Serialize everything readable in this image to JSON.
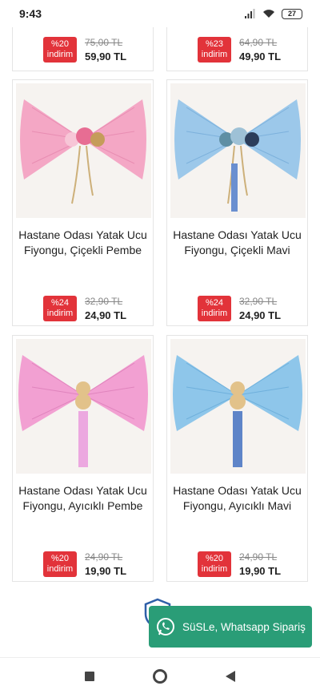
{
  "status_bar": {
    "time": "9:43",
    "battery": "27"
  },
  "products_top": [
    {
      "discount_pct": "%20",
      "discount_word": "indirim",
      "old_price": "75,00 TL",
      "new_price": "59,90 TL"
    },
    {
      "discount_pct": "%23",
      "discount_word": "indirim",
      "old_price": "64,90 TL",
      "new_price": "49,90 TL"
    }
  ],
  "products": [
    {
      "title": "Hastane Odası Yatak Ucu Fiyongu, Çiçekli Pembe",
      "discount_pct": "%24",
      "discount_word": "indirim",
      "old_price": "32,90 TL",
      "new_price": "24,90 TL",
      "color": "#f4a7c5",
      "image_icon": "pink-bow-flowers"
    },
    {
      "title": "Hastane Odası Yatak Ucu Fiyongu, Çiçekli Mavi",
      "discount_pct": "%24",
      "discount_word": "indirim",
      "old_price": "32,90 TL",
      "new_price": "24,90 TL",
      "color": "#9cc8ea",
      "image_icon": "blue-bow-flowers"
    },
    {
      "title": "Hastane Odası Yatak Ucu Fiyongu, Ayıcıklı Pembe",
      "discount_pct": "%20",
      "discount_word": "indirim",
      "old_price": "24,90 TL",
      "new_price": "19,90 TL",
      "color": "#f2a0d2",
      "image_icon": "pink-bow-teddy"
    },
    {
      "title": "Hastane Odası Yatak Ucu Fiyongu, Ayıcıklı Mavi",
      "discount_pct": "%20",
      "discount_word": "indirim",
      "old_price": "24,90 TL",
      "new_price": "19,90 TL",
      "color": "#8ec6ea",
      "image_icon": "blue-bow-teddy"
    }
  ],
  "whatsapp": {
    "label": "SüSLe, Whatsapp Sipariş",
    "color": "#2a9d77"
  },
  "colors": {
    "discount_badge": "#e2333a"
  }
}
